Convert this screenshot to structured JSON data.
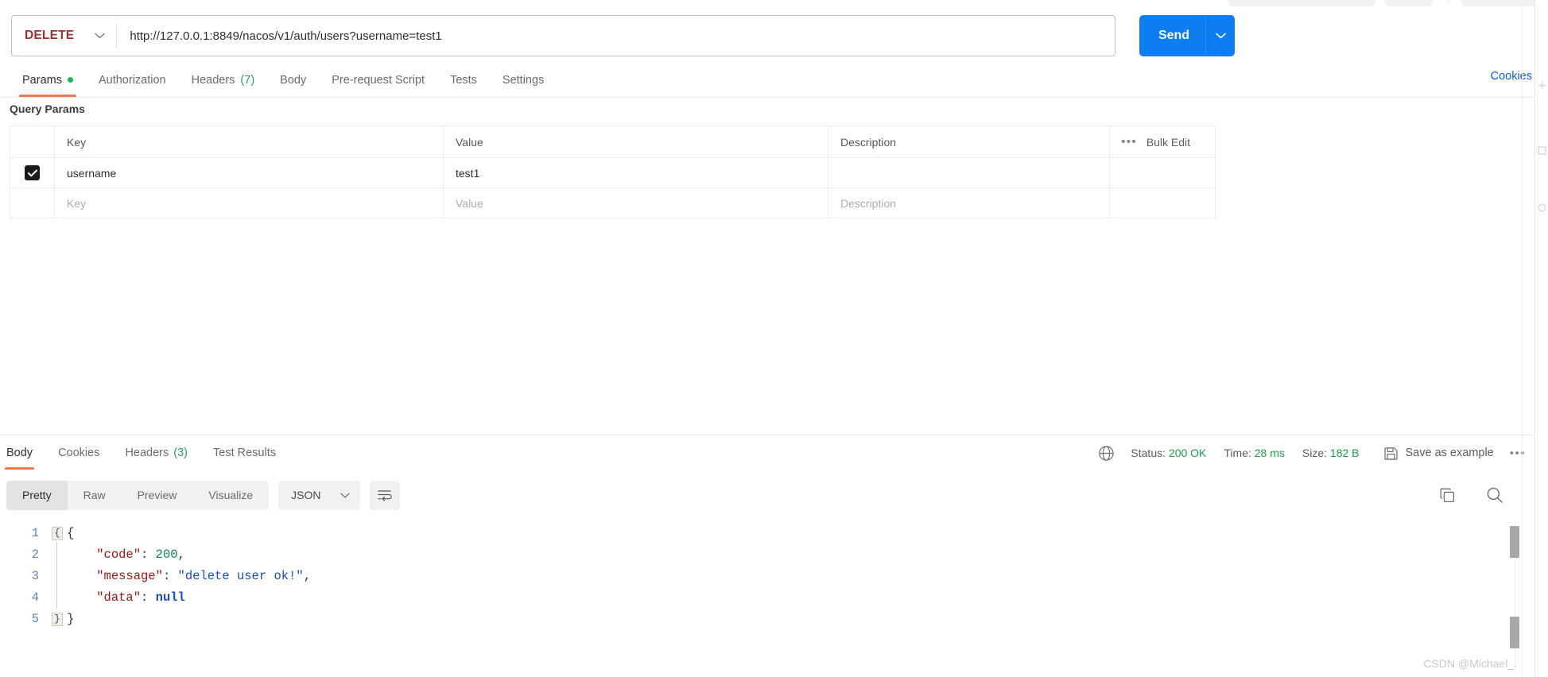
{
  "request": {
    "method": "DELETE",
    "url": "http://127.0.0.1:8849/nacos/v1/auth/users?username=test1",
    "send_label": "Send",
    "cookies_link": "Cookies",
    "tabs": [
      {
        "label": "Params",
        "badge": "dot",
        "count": "",
        "active": true
      },
      {
        "label": "Authorization",
        "badge": "",
        "count": "",
        "active": false
      },
      {
        "label": "Headers",
        "badge": "count",
        "count": "(7)",
        "active": false
      },
      {
        "label": "Body",
        "badge": "",
        "count": "",
        "active": false
      },
      {
        "label": "Pre-request Script",
        "badge": "",
        "count": "",
        "active": false
      },
      {
        "label": "Tests",
        "badge": "",
        "count": "",
        "active": false
      },
      {
        "label": "Settings",
        "badge": "",
        "count": "",
        "active": false
      }
    ]
  },
  "query_params": {
    "section_title": "Query Params",
    "headers": {
      "key": "Key",
      "value": "Value",
      "description": "Description",
      "bulk_edit": "Bulk Edit"
    },
    "rows": [
      {
        "checked": true,
        "key": "username",
        "value": "test1",
        "description": ""
      }
    ],
    "placeholder_row": {
      "key": "Key",
      "value": "Value",
      "description": "Description"
    }
  },
  "response": {
    "tabs": [
      {
        "label": "Body",
        "count": "",
        "active": true
      },
      {
        "label": "Cookies",
        "count": "",
        "active": false
      },
      {
        "label": "Headers",
        "count": "(3)",
        "active": false
      },
      {
        "label": "Test Results",
        "count": "",
        "active": false
      }
    ],
    "status_label": "Status:",
    "status_value": "200 OK",
    "time_label": "Time:",
    "time_value": "28 ms",
    "size_label": "Size:",
    "size_value": "182 B",
    "save_as_example": "Save as example",
    "more": "•••",
    "format_tabs": [
      {
        "label": "Pretty",
        "active": true
      },
      {
        "label": "Raw",
        "active": false
      },
      {
        "label": "Preview",
        "active": false
      },
      {
        "label": "Visualize",
        "active": false
      }
    ],
    "language": "JSON",
    "line_numbers": [
      "1",
      "2",
      "3",
      "4",
      "5"
    ],
    "body_json": {
      "code": 200,
      "message": "delete user ok!",
      "data": null
    }
  },
  "colors": {
    "accent_orange": "#f2784b",
    "send_blue": "#0d7ef2",
    "link_blue": "#0a5fd6",
    "status_green": "#1a9e4b",
    "method_red": "#a03030"
  },
  "watermark": "CSDN @Michael_."
}
